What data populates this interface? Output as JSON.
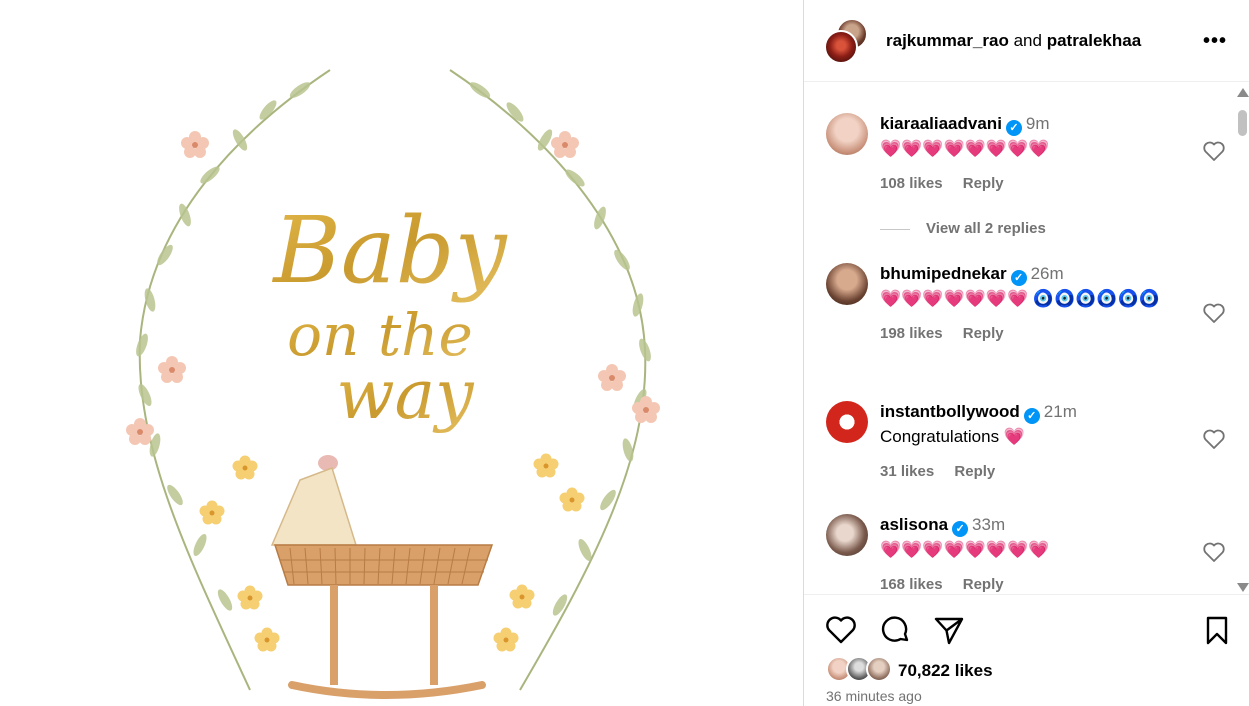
{
  "post": {
    "author1": "rajkummar_rao",
    "connector": "and",
    "author2": "patralekhaa",
    "more_icon": "ellipsis-icon",
    "image_text": {
      "line1": "Baby",
      "line2": "on the",
      "line3": "way"
    }
  },
  "comments": [
    {
      "user": "kiaraaliaadvani",
      "verified": true,
      "time": "9m",
      "text": "💗💗💗💗💗💗💗💗",
      "likes": "108 likes",
      "reply": "Reply"
    },
    {
      "user": "bhumipednekar",
      "verified": true,
      "time": "26m",
      "text": "💗💗💗💗💗💗💗 🧿🧿🧿🧿🧿🧿",
      "likes": "198 likes",
      "reply": "Reply"
    },
    {
      "user": "instantbollywood",
      "verified": true,
      "time": "21m",
      "text": "Congratulations 💗",
      "likes": "31 likes",
      "reply": "Reply"
    },
    {
      "user": "aslisona",
      "verified": true,
      "time": "33m",
      "text": "💗💗💗💗💗💗💗💗",
      "likes": "168 likes",
      "reply": "Reply"
    }
  ],
  "view_replies": "View all 2 replies",
  "likes_total": "70,822 likes",
  "time_ago": "36 minutes ago",
  "colors": {
    "verified": "#0095f6",
    "muted": "#737373",
    "gold": "#d8a93a"
  }
}
